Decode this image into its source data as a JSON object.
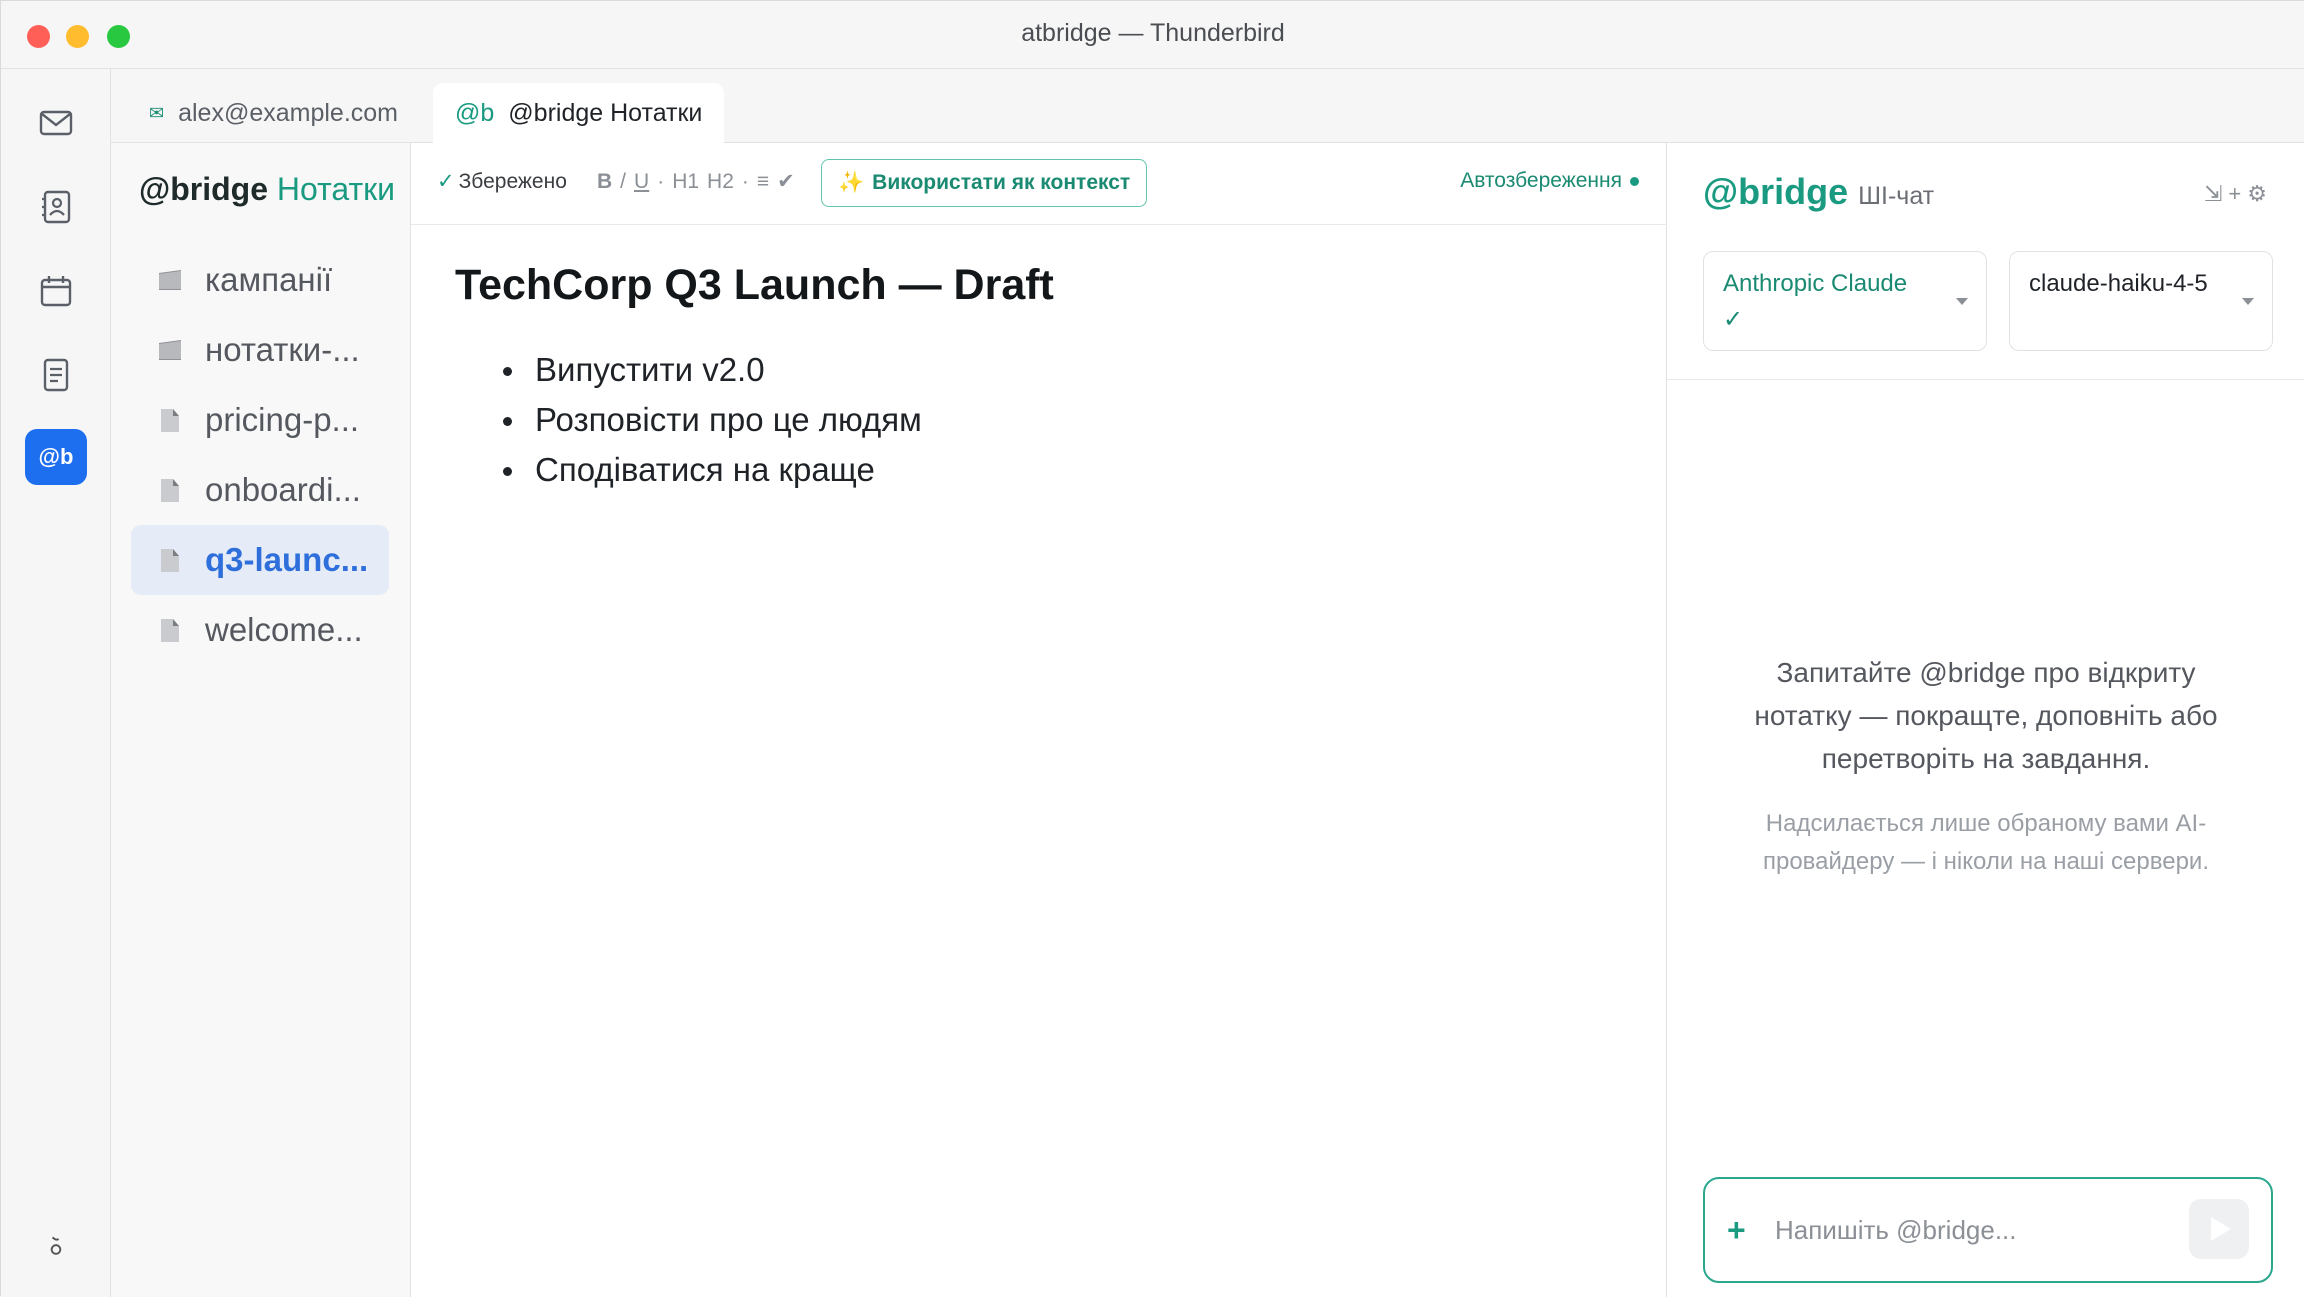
{
  "window": {
    "title": "atbridge — Thunderbird"
  },
  "rail": {
    "items": [
      {
        "name": "mail-icon"
      },
      {
        "name": "address-book-icon"
      },
      {
        "name": "calendar-icon"
      },
      {
        "name": "notes-icon"
      },
      {
        "name": "atbridge-icon",
        "label": "@b",
        "active": true
      }
    ],
    "bottom_icon": "account-icon"
  },
  "tabs": [
    {
      "icon": "mail-icon",
      "label": "alex@example.com",
      "active": false
    },
    {
      "icon_label": "@b",
      "label": "@bridge Нотатки",
      "active": true
    }
  ],
  "notes": {
    "title_brand": "@bridge",
    "title_rest": " Нотатки",
    "items": [
      {
        "label": "кампанії",
        "type": "folder"
      },
      {
        "label": "нотатки-...",
        "type": "folder"
      },
      {
        "label": "pricing-p...",
        "type": "file"
      },
      {
        "label": "onboardi...",
        "type": "file"
      },
      {
        "label": "q3-launc...",
        "type": "file",
        "active": true
      },
      {
        "label": "welcome...",
        "type": "file"
      }
    ]
  },
  "editor": {
    "saved_label": "Збережено",
    "format": {
      "bold": "B",
      "sep1": "/",
      "underline": "U",
      "dot1": "·",
      "h1": "H1",
      "h2": "H2",
      "dot2": "·",
      "list": "≡",
      "check": "✔"
    },
    "context_button": "Використати як контекст",
    "autosave_label": "Автозбереження",
    "doc_title": "TechCorp Q3 Launch — Draft",
    "bullets": [
      "Випустити v2.0",
      "Розповісти про це людям",
      "Сподіватися на краще"
    ]
  },
  "chat": {
    "brand": "@bridge",
    "subtitle": "ШІ-чат",
    "actions": {
      "collapse": "⇲",
      "add": "+",
      "settings": "⚙"
    },
    "provider": {
      "value": "Anthropic Claude",
      "status": "✓"
    },
    "model": {
      "value": "claude-haiku-4-5"
    },
    "empty_text": "Запитайте @bridge про відкриту нотатку — покращте, доповніть або перетворіть на завдання.",
    "privacy_note": "Надсилається лише обраному вами AI-провайдеру — і ніколи на наші сервери.",
    "composer": {
      "plus": "+",
      "placeholder": "Напишіть @bridge..."
    }
  },
  "colors": {
    "accent": "#1a9a80",
    "brand_blue": "#1e6ff0",
    "active_note": "#2f6fdb"
  }
}
